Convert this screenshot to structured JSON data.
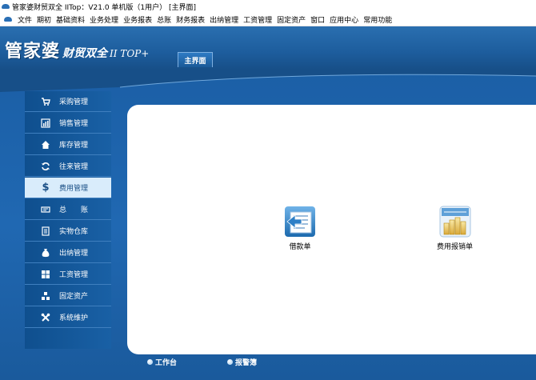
{
  "window": {
    "title": "管家婆财贸双全 IITop：V21.0 单机版（1用户）    [主界面]"
  },
  "menubar": {
    "items": [
      "文件",
      "期初",
      "基础资料",
      "业务处理",
      "业务报表",
      "总账",
      "财务报表",
      "出纳管理",
      "工资管理",
      "固定资产",
      "窗口",
      "应用中心",
      "常用功能"
    ]
  },
  "header": {
    "logo_main": "管家婆",
    "logo_sub": "财贸双全",
    "logo_version": "II TOP+",
    "active_tab": "主界面"
  },
  "sidebar": {
    "items": [
      {
        "label": "采购管理",
        "icon": "cart-icon"
      },
      {
        "label": "销售管理",
        "icon": "chart-icon"
      },
      {
        "label": "库存管理",
        "icon": "home-icon"
      },
      {
        "label": "往来管理",
        "icon": "refresh-icon"
      },
      {
        "label": "费用管理",
        "icon": "dollar-icon"
      },
      {
        "label": "总　　账",
        "icon": "ledger-icon"
      },
      {
        "label": "实物仓库",
        "icon": "warehouse-icon"
      },
      {
        "label": "出纳管理",
        "icon": "moneybag-icon"
      },
      {
        "label": "工资管理",
        "icon": "grid-icon"
      },
      {
        "label": "固定资产",
        "icon": "assets-icon"
      },
      {
        "label": "系统维护",
        "icon": "tools-icon"
      }
    ],
    "active_index": 4
  },
  "content": {
    "modules": [
      {
        "label": "借款单",
        "icon": "loan-document-icon"
      },
      {
        "label": "费用报销单",
        "icon": "expense-report-icon"
      }
    ]
  },
  "bottombar": {
    "workbench": "工作台",
    "alerts": "报警簿"
  },
  "colors": {
    "primary_blue": "#1b5fa6",
    "sidebar_active_bg": "#d9ecfb",
    "content_bg": "#ffffff"
  }
}
